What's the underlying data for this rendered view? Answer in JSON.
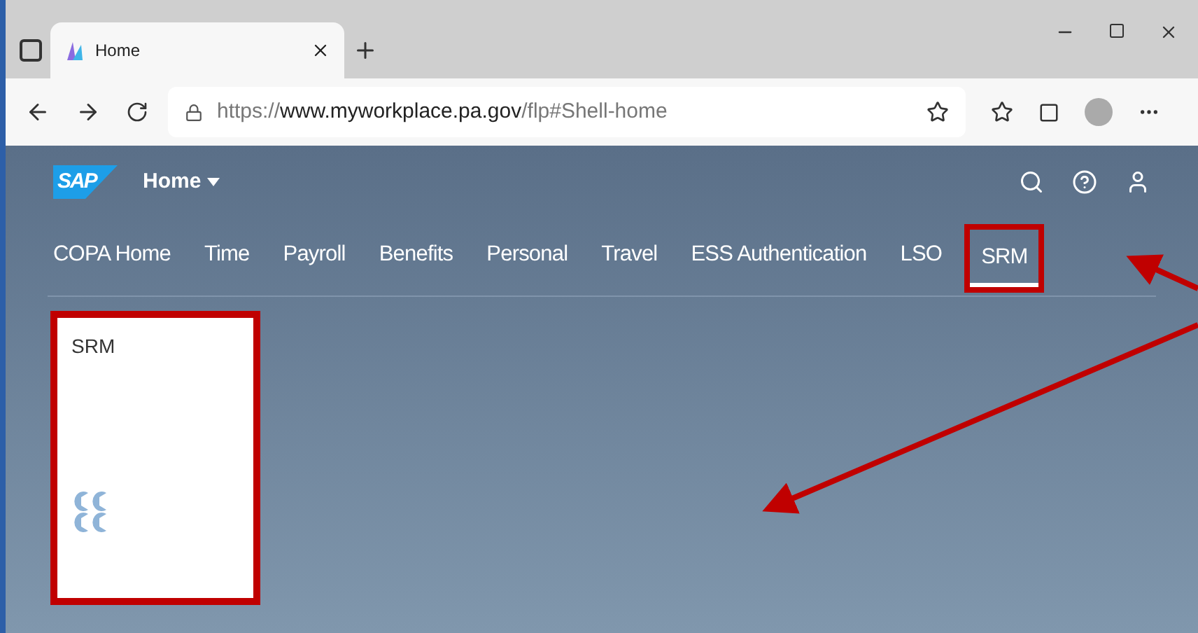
{
  "browser": {
    "tabs": [
      {
        "title": "Home",
        "selected": true
      }
    ],
    "url": {
      "scheme": "https://",
      "host": "www.myworkplace.pa.gov",
      "path": "/flp#Shell-home"
    }
  },
  "shell": {
    "logo": "SAP",
    "title": "Home",
    "nav": [
      {
        "label": "COPA Home",
        "selected": false,
        "highlighted": false
      },
      {
        "label": "Time",
        "selected": false,
        "highlighted": false
      },
      {
        "label": "Payroll",
        "selected": false,
        "highlighted": false
      },
      {
        "label": "Benefits",
        "selected": false,
        "highlighted": false
      },
      {
        "label": "Personal",
        "selected": false,
        "highlighted": false
      },
      {
        "label": "Travel",
        "selected": false,
        "highlighted": false
      },
      {
        "label": "ESS Authentication",
        "selected": false,
        "highlighted": false
      },
      {
        "label": "LSO",
        "selected": false,
        "highlighted": false
      },
      {
        "label": "SRM",
        "selected": true,
        "highlighted": true
      }
    ],
    "tiles": [
      {
        "title": "SRM",
        "highlighted": true
      }
    ]
  },
  "annotations": [
    {
      "kind": "arrow"
    },
    {
      "kind": "arrow"
    }
  ]
}
